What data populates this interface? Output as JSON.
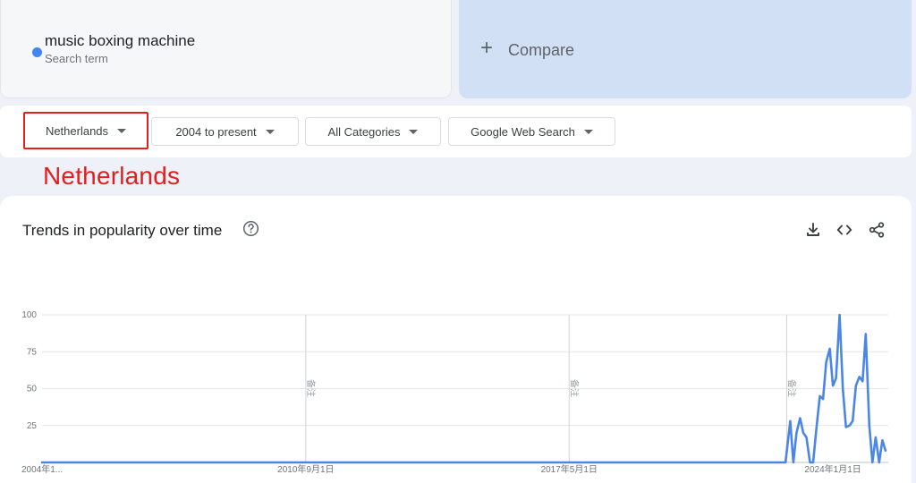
{
  "search_term": {
    "name": "music boxing machine",
    "subtitle": "Search term",
    "color": "#4285f4"
  },
  "compare": {
    "label": "Compare",
    "icon": "plus-icon"
  },
  "filters": {
    "geo": "Netherlands",
    "time": "2004 to present",
    "category": "All Categories",
    "property": "Google Web Search"
  },
  "annotation": {
    "text": "Netherlands",
    "color": "#e02020"
  },
  "chart": {
    "title": "Trends in popularity over time",
    "icons": [
      "help-icon",
      "download-icon",
      "embed-icon",
      "share-icon"
    ],
    "note_label": "备注"
  },
  "chart_data": {
    "type": "line",
    "series": [
      {
        "name": "music boxing machine",
        "color": "#4a86e8",
        "points": [
          [
            2004.0,
            0
          ],
          [
            2022.0,
            0
          ],
          [
            2022.8,
            0
          ],
          [
            2022.92,
            28
          ],
          [
            2023.0,
            0
          ],
          [
            2023.08,
            20
          ],
          [
            2023.17,
            30
          ],
          [
            2023.25,
            20
          ],
          [
            2023.33,
            17
          ],
          [
            2023.42,
            0
          ],
          [
            2023.5,
            0
          ],
          [
            2023.58,
            22
          ],
          [
            2023.67,
            45
          ],
          [
            2023.75,
            43
          ],
          [
            2023.83,
            68
          ],
          [
            2023.92,
            77
          ],
          [
            2024.0,
            52
          ],
          [
            2024.08,
            57
          ],
          [
            2024.17,
            100
          ],
          [
            2024.25,
            50
          ],
          [
            2024.33,
            24
          ],
          [
            2024.42,
            25
          ],
          [
            2024.5,
            28
          ],
          [
            2024.58,
            52
          ],
          [
            2024.67,
            58
          ],
          [
            2024.75,
            55
          ],
          [
            2024.83,
            87
          ],
          [
            2024.92,
            25
          ],
          [
            2025.0,
            0
          ],
          [
            2025.08,
            17
          ],
          [
            2025.17,
            0
          ],
          [
            2025.25,
            15
          ],
          [
            2025.33,
            8
          ]
        ]
      }
    ],
    "x_ticks": [
      {
        "x": 2004.0,
        "label": "2004年1..."
      },
      {
        "x": 2010.67,
        "label": "2010年9月1日"
      },
      {
        "x": 2017.33,
        "label": "2017年5月1日"
      },
      {
        "x": 2024.0,
        "label": "2024年1月1日"
      }
    ],
    "y_ticks": [
      100,
      75,
      50,
      25
    ],
    "ylim": [
      0,
      100
    ],
    "xlim": [
      2004.0,
      2025.4
    ],
    "note_markers": [
      2010.67,
      2017.33,
      2022.83
    ],
    "grid": true
  }
}
